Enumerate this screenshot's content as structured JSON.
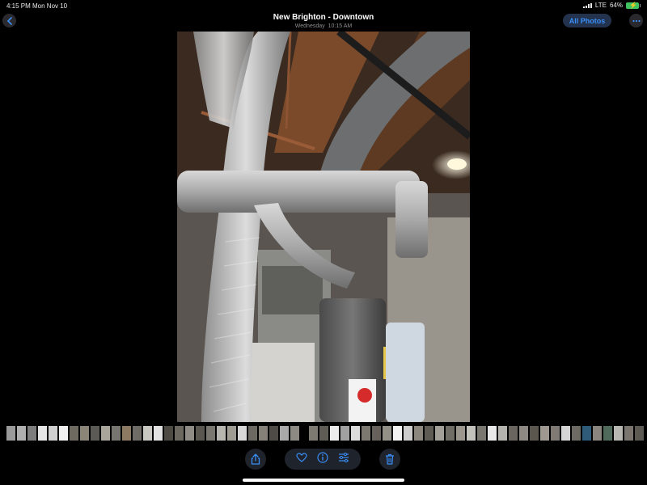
{
  "status": {
    "time": "4:15 PM",
    "date": "Mon Nov 10",
    "network": "LTE",
    "battery": "64%"
  },
  "header": {
    "back_icon": "chevron-left-icon",
    "title": "New Brighton - Downtown",
    "subtitle_day": "Wednesday",
    "subtitle_time": "10:15 AM",
    "all_photos_label": "All Photos",
    "more_icon": "ellipsis-icon"
  },
  "photo": {
    "subject": "basement-furnace-ductwork-photo"
  },
  "toolbar": {
    "share_icon": "share-icon",
    "favorite_icon": "heart-icon",
    "info_icon": "info-icon",
    "adjust_icon": "sliders-icon",
    "delete_icon": "trash-icon"
  },
  "colors": {
    "accent": "#3a8ef7",
    "pill": "#1f232b",
    "battery": "#3fc35e",
    "background": "#000000"
  },
  "thumbnails": [
    "#9a9a9a",
    "#b0b0b0",
    "#7d7d7d",
    "#e6e6e6",
    "#cfcfcf",
    "#f0f0f0",
    "#6e6a60",
    "#8a8577",
    "#5c5a54",
    "#a9a59a",
    "#77756f",
    "#8c7a62",
    "#6f6b66",
    "#c9c7c2",
    "#e2e2e2",
    "#4d4a44",
    "#6b685f",
    "#8f8c85",
    "#5a5650",
    "#7a7670",
    "#b8b6b0",
    "#9f9c94",
    "#d8d8d8",
    "#6c6862",
    "#858078",
    "#4e4a46",
    "#aaaaaa",
    "#8d8a84",
    "GAP",
    "#7e7a72",
    "#5f5b55",
    "#ececec",
    "#a0a0a0",
    "#dcdcdc",
    "#7c786f",
    "#66625b",
    "#939088",
    "#f2f2f2",
    "#cccccc",
    "#8b877f",
    "#5e5a54",
    "#a3a09a",
    "#706c66",
    "#9b978f",
    "#c4c2bd",
    "#7a7670",
    "#e8e8e8",
    "#b5b3ad",
    "#6a665f",
    "#8e8a83",
    "#5b574f",
    "#9e9a92",
    "#7f7b74",
    "#d5d5d5",
    "#6d6963",
    "#2f5a78",
    "#8a867f",
    "#4f6a5a",
    "#b9b7b1",
    "#7a766f",
    "#5d5a53"
  ]
}
